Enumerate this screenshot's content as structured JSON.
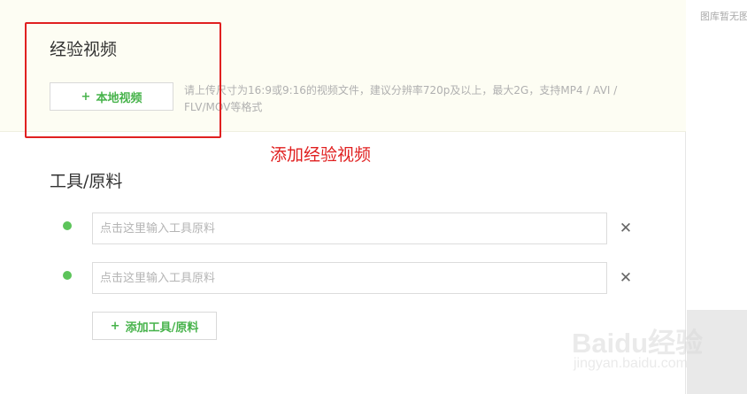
{
  "video_section": {
    "title": "经验视频",
    "upload_button_icon": "+",
    "upload_button_label": "本地视频",
    "hint": "请上传尺寸为16:9或9:16的视频文件，建议分辨率720p及以上，最大2G，支持MP4 / AVI / FLV/MOV等格式"
  },
  "annotation": {
    "text": "添加经验视频",
    "color": "#e02020"
  },
  "tools_section": {
    "title": "工具/原料",
    "rows": [
      {
        "placeholder": "点击这里输入工具原料",
        "value": "",
        "remove_icon": "✕"
      },
      {
        "placeholder": "点击这里输入工具原料",
        "value": "",
        "remove_icon": "✕"
      }
    ],
    "add_button_icon": "+",
    "add_button_label": "添加工具/原料"
  },
  "sidebar": {
    "text": "图库暂无图片"
  },
  "watermark": {
    "logo": "Baidu经验",
    "url": "jingyan.baidu.com"
  },
  "colors": {
    "accent_green": "#47b34b",
    "bullet_green": "#5cc45a",
    "video_bg": "#fdfdf3"
  }
}
